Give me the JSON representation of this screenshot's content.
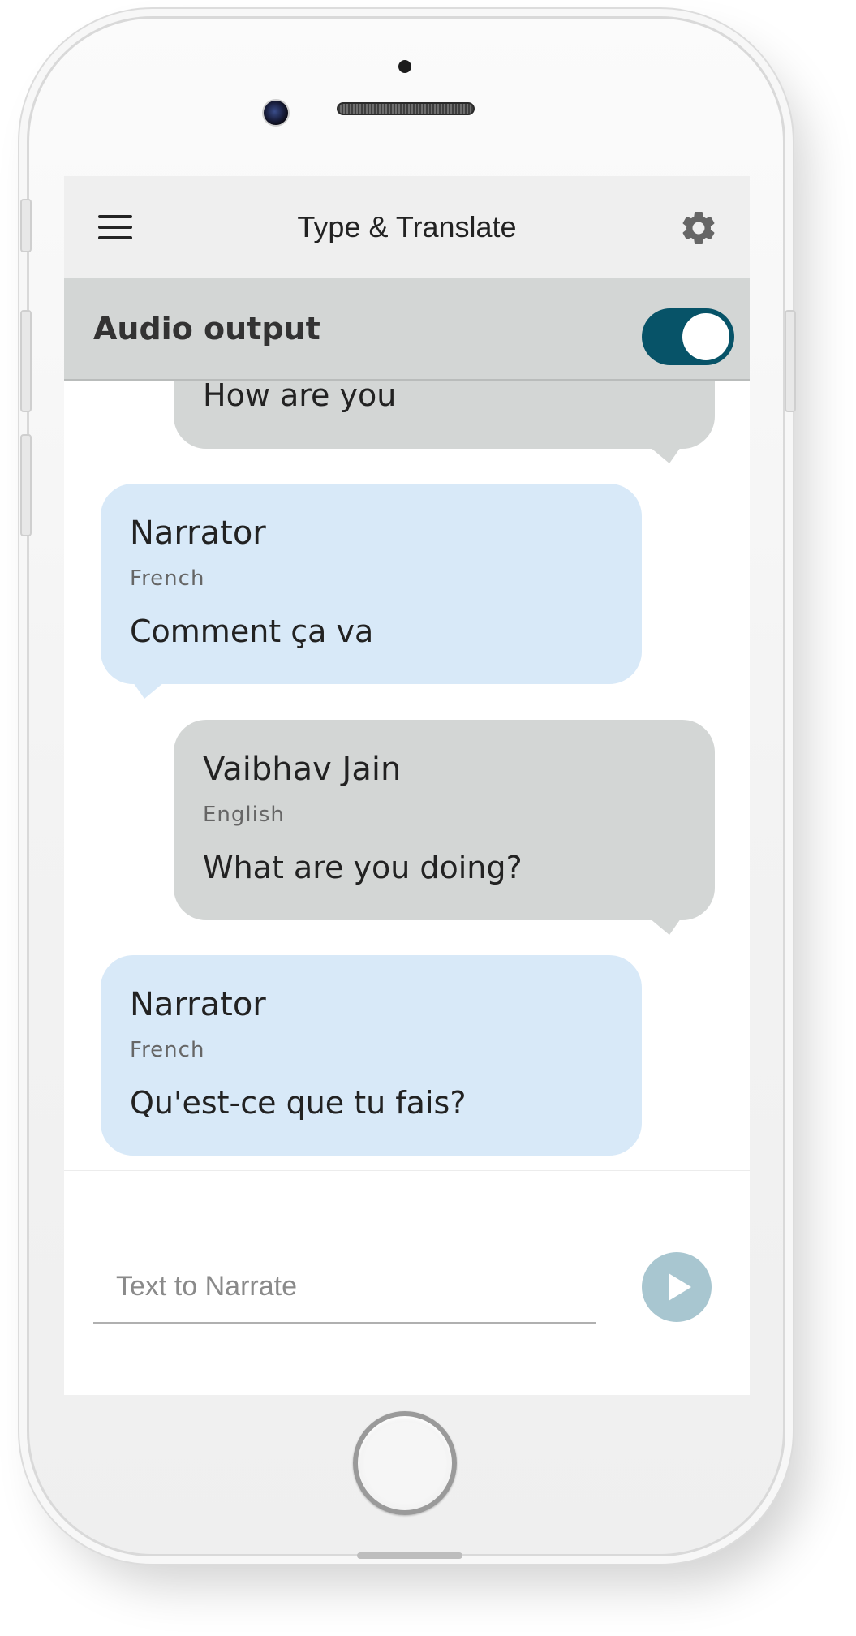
{
  "app": {
    "title": "Type & Translate"
  },
  "audio": {
    "label": "Audio output",
    "enabled": true
  },
  "messages": [
    {
      "side": "sent",
      "name": "",
      "language": "",
      "text": "How are you"
    },
    {
      "side": "received",
      "name": "Narrator",
      "language": "French",
      "text": "Comment ça va"
    },
    {
      "side": "sent",
      "name": "Vaibhav Jain",
      "language": "English",
      "text": "What are you doing?"
    },
    {
      "side": "received",
      "name": "Narrator",
      "language": "French",
      "text": "Qu'est-ce que tu fais?"
    }
  ],
  "composer": {
    "placeholder": "Text to Narrate",
    "value": ""
  },
  "colors": {
    "toggle_on": "#075368",
    "sent_bubble": "#d3d6d5",
    "received_bubble": "#d8e9f8",
    "play_button": "#a8c6d0"
  },
  "icons": {
    "menu": "menu-icon",
    "settings": "gear-icon",
    "play": "play-icon"
  }
}
